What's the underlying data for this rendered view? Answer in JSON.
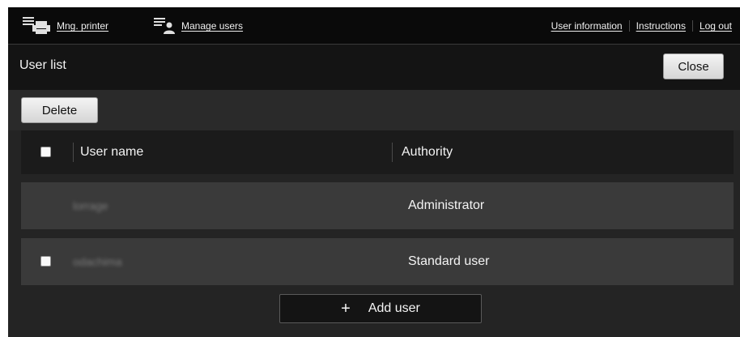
{
  "topbar": {
    "mng_printer_label": "Mng. printer",
    "manage_users_label": "Manage users",
    "right_links": [
      "User information",
      "Instructions",
      "Log out"
    ]
  },
  "header": {
    "title": "User list",
    "close_label": "Close"
  },
  "toolbar": {
    "delete_label": "Delete"
  },
  "table": {
    "columns": [
      "User name",
      "Authority"
    ],
    "rows": [
      {
        "username": "lorrage",
        "authority": "Administrator"
      },
      {
        "username": "odachima",
        "authority": "Standard user"
      }
    ]
  },
  "footer": {
    "add_user_label": "Add user",
    "add_user_icon": "plus-icon"
  },
  "colors": {
    "background": "#242424",
    "topbar": "#0a0a0a",
    "row": "#3a3a3a",
    "header": "#141414"
  }
}
